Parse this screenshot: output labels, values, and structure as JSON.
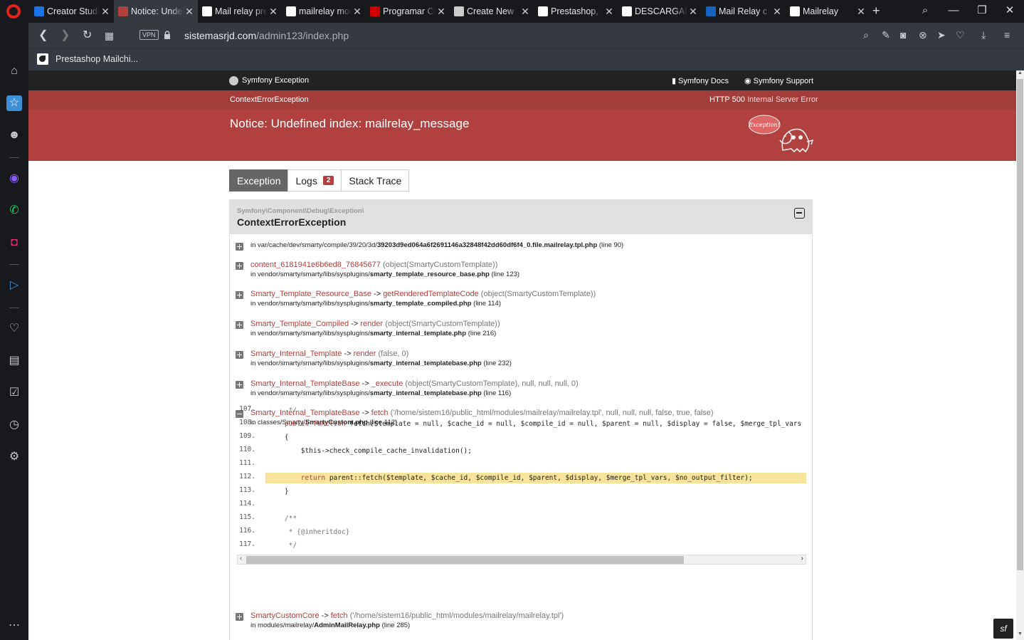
{
  "browser": {
    "tabs": [
      {
        "title": "Creator Studio",
        "favicon_color": "#1a73e8",
        "favicon": "play-square-icon"
      },
      {
        "title": "Notice: Undefined index",
        "favicon_color": "#b0413e",
        "favicon": "symfony-ghost-icon"
      },
      {
        "title": "Mail relay prestashop",
        "favicon_color": "#ffffff",
        "favicon": "google-icon"
      },
      {
        "title": "mailrelay module",
        "favicon_color": "#ffffff",
        "favicon": "google-icon"
      },
      {
        "title": "Programar Cursos",
        "favicon_color": "#d00000",
        "favicon": "udemy-icon"
      },
      {
        "title": "Create New",
        "favicon_color": "#cccccc",
        "favicon": "circle-icon"
      },
      {
        "title": "Prestashop,",
        "favicon_color": "#ffffff",
        "favicon": "mail-icon"
      },
      {
        "title": "DESCARGAR",
        "favicon_color": "#ffffff",
        "favicon": "mail-icon"
      },
      {
        "title": "Mail Relay c",
        "favicon_color": "#1565c0",
        "favicon": "trello-icon"
      },
      {
        "title": "Mailrelay",
        "favicon_color": "#ffffff",
        "favicon": "mail-icon"
      }
    ],
    "vpn_label": "VPN",
    "url_host": "sistemasrjd.com",
    "url_path": "/admin123/index.php",
    "bookmark": "Prestashop Mailchi..."
  },
  "symfony_header": {
    "brand": "Symfony Exception",
    "docs": "Symfony Docs",
    "support": "Symfony Support"
  },
  "exception": {
    "class": "ContextErrorException",
    "http_code": "HTTP 500",
    "http_text": "Internal Server Error",
    "message": "Notice: Undefined index: mailrelay_message",
    "ghost_label": "Exception!"
  },
  "page_tabs": {
    "exception": "Exception",
    "logs": "Logs",
    "logs_count": "2",
    "stack_trace": "Stack Trace"
  },
  "trace_header": {
    "namespace": "Symfony\\Component\\Debug\\Exception\\",
    "class": "ContextErrorException"
  },
  "frames": [
    {
      "toggle": "plus",
      "call_class": "",
      "call_sep": "",
      "call_fn": "",
      "args": "",
      "loc_prefix": "in var/cache/dev/smarty/compile/39/20/3d/",
      "loc_file": "39203d9ed064a6f2691146a32848f42dd60df6f4_0.file.mailrelay.tpl.php",
      "loc_line": "(line 90)"
    },
    {
      "toggle": "plus",
      "call_class": "",
      "call_sep": "",
      "call_fn": "content_6181941e6b6ed8_76845677",
      "args": "(object(SmartyCustomTemplate))",
      "loc_prefix": "in vendor/smarty/smarty/libs/sysplugins/",
      "loc_file": "smarty_template_resource_base.php",
      "loc_line": "(line 123)"
    },
    {
      "toggle": "plus",
      "call_class": "Smarty_Template_Resource_Base",
      "call_sep": " -> ",
      "call_fn": "getRenderedTemplateCode",
      "args": "(object(SmartyCustomTemplate))",
      "loc_prefix": "in vendor/smarty/smarty/libs/sysplugins/",
      "loc_file": "smarty_template_compiled.php",
      "loc_line": "(line 114)"
    },
    {
      "toggle": "plus",
      "call_class": "Smarty_Template_Compiled",
      "call_sep": " -> ",
      "call_fn": "render",
      "args": "(object(SmartyCustomTemplate))",
      "loc_prefix": "in vendor/smarty/smarty/libs/sysplugins/",
      "loc_file": "smarty_internal_template.php",
      "loc_line": "(line 216)"
    },
    {
      "toggle": "plus",
      "call_class": "Smarty_Internal_Template",
      "call_sep": " -> ",
      "call_fn": "render",
      "args": "(false, 0)",
      "loc_prefix": "in vendor/smarty/smarty/libs/sysplugins/",
      "loc_file": "smarty_internal_templatebase.php",
      "loc_line": "(line 232)"
    },
    {
      "toggle": "plus",
      "call_class": "Smarty_Internal_TemplateBase",
      "call_sep": " -> ",
      "call_fn": "_execute",
      "args": "(object(SmartyCustomTemplate), null, null, null, 0)",
      "loc_prefix": "in vendor/smarty/smarty/libs/sysplugins/",
      "loc_file": "smarty_internal_templatebase.php",
      "loc_line": "(line 116)"
    },
    {
      "toggle": "minus",
      "call_class": "Smarty_Internal_TemplateBase",
      "call_sep": " -> ",
      "call_fn": "fetch",
      "args": "('/home/sistem16/public_html/modules/mailrelay/mailrelay.tpl', null, null, null, false, true, false)",
      "loc_prefix": "in classes/Smarty/",
      "loc_file": "SmartyCustom.php",
      "loc_line": "(line 112)"
    },
    {
      "toggle": "plus",
      "call_class": "SmartyCustomCore",
      "call_sep": " -> ",
      "call_fn": "fetch",
      "args": "('/home/sistem16/public_html/modules/mailrelay/mailrelay.tpl')",
      "loc_prefix": "in modules/mailrelay/",
      "loc_file": "AdminMailRelay.php",
      "loc_line": "(line 285)"
    }
  ],
  "code": [
    {
      "n": "107.",
      "src": "     */"
    },
    {
      "n": "108.",
      "src": "    public function fetch($template = null, $cache_id = null, $compile_id = null, $parent = null, $display = false, $merge_tpl_vars"
    },
    {
      "n": "109.",
      "src": "    {"
    },
    {
      "n": "110.",
      "src": "        $this->check_compile_cache_invalidation();"
    },
    {
      "n": "111.",
      "src": ""
    },
    {
      "n": "112.",
      "src": "        return parent::fetch($template, $cache_id, $compile_id, $parent, $display, $merge_tpl_vars, $no_output_filter);"
    },
    {
      "n": "113.",
      "src": "    }"
    },
    {
      "n": "114.",
      "src": ""
    },
    {
      "n": "115.",
      "src": "    /**"
    },
    {
      "n": "116.",
      "src": "     * {@inheritdoc}"
    },
    {
      "n": "117.",
      "src": "     */"
    }
  ],
  "highlight_line": "112."
}
